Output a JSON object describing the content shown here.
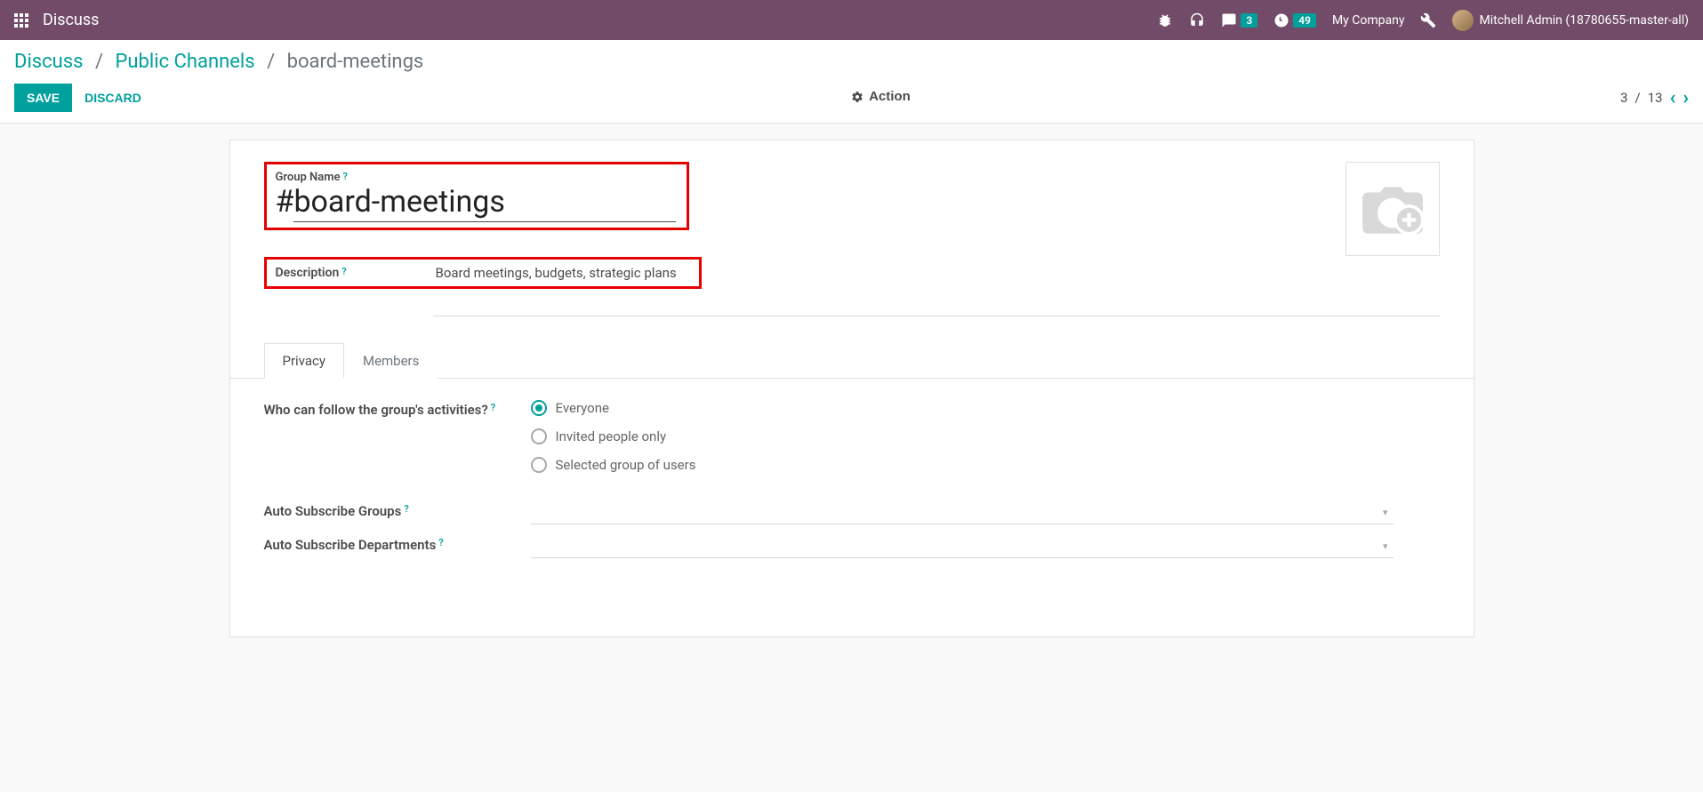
{
  "navbar": {
    "brand": "Discuss",
    "messages_count": "3",
    "activities_count": "49",
    "company": "My Company",
    "user": "Mitchell Admin (18780655-master-all)"
  },
  "breadcrumb": {
    "root": "Discuss",
    "section": "Public Channels",
    "current": "board-meetings"
  },
  "buttons": {
    "save": "SAVE",
    "discard": "DISCARD",
    "action": "Action"
  },
  "pager": {
    "current": "3",
    "total": "13"
  },
  "form": {
    "group_name_label": "Group Name",
    "group_name_prefix": "#",
    "group_name_value": "board-meetings",
    "description_label": "Description",
    "description_value": "Board meetings, budgets, strategic plans",
    "help": "?"
  },
  "tabs": {
    "privacy": "Privacy",
    "members": "Members"
  },
  "privacy": {
    "who_follow_label": "Who can follow the group's activities?",
    "options": {
      "everyone": "Everyone",
      "invited": "Invited people only",
      "group": "Selected group of users"
    },
    "auto_subscribe_groups": "Auto Subscribe Groups",
    "auto_subscribe_departments": "Auto Subscribe Departments"
  }
}
